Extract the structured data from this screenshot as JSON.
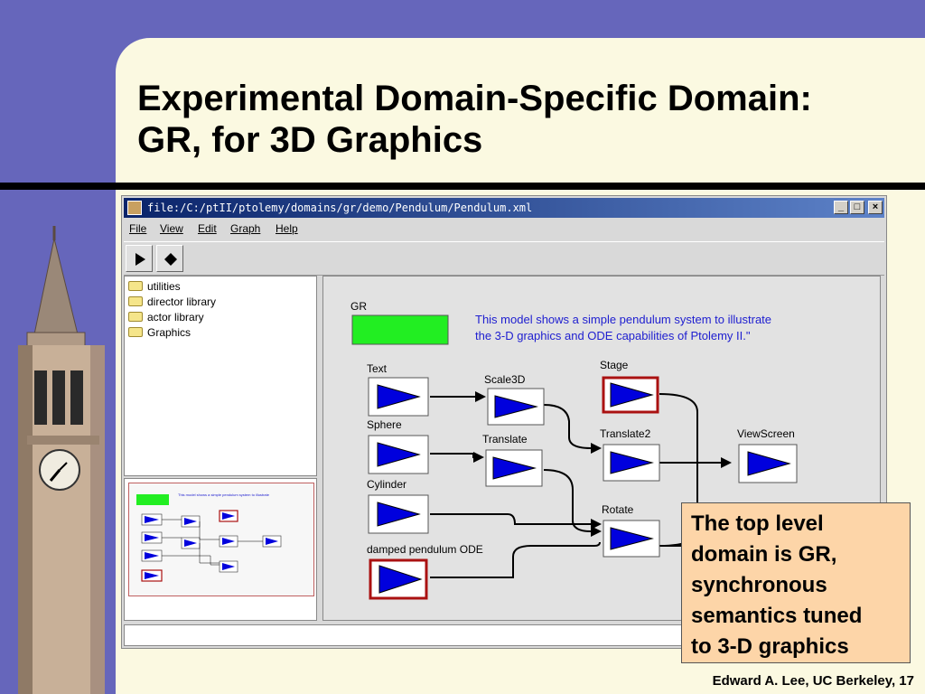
{
  "slide": {
    "title_lines": [
      "Experimental Domain-Specific Domain:",
      "GR, for 3D Graphics"
    ],
    "footer": "Edward A. Lee, UC Berkeley, 17",
    "callout_lines": [
      "The top level",
      "domain is GR,",
      "synchronous",
      "semantics tuned",
      "to 3-D graphics"
    ]
  },
  "window": {
    "title": "file:/C:/ptII/ptolemy/domains/gr/demo/Pendulum/Pendulum.xml",
    "controls": {
      "minimize": "_",
      "maximize": "□",
      "close": "×"
    },
    "menu": [
      "File",
      "View",
      "Edit",
      "Graph",
      "Help"
    ],
    "toolbar": [
      {
        "icon": "play-icon"
      },
      {
        "icon": "stop-icon"
      }
    ]
  },
  "library": [
    "utilities",
    "director library",
    "actor library",
    "Graphics"
  ],
  "graph": {
    "director": "GR",
    "annotation_lines": [
      "This model shows a simple pendulum system to illustrate",
      "the 3-D graphics and ODE capabilities of Ptolemy II.\""
    ],
    "actors": {
      "text": "Text",
      "sphere": "Sphere",
      "cylinder": "Cylinder",
      "ode": "damped pendulum ODE",
      "scale3d": "Scale3D",
      "translate": "Translate",
      "stage": "Stage",
      "translate2": "Translate2",
      "rotate": "Rotate",
      "viewscreen": "ViewScreen"
    }
  },
  "colors": {
    "slide_bg": "#6666bb",
    "panel_bg": "#fbf9e1",
    "callout_bg": "#fdd5a8",
    "director_green": "#22ee22",
    "actor_blue": "#0000dd",
    "annotation_blue": "#2020d0",
    "composite_red": "#aa1111"
  }
}
